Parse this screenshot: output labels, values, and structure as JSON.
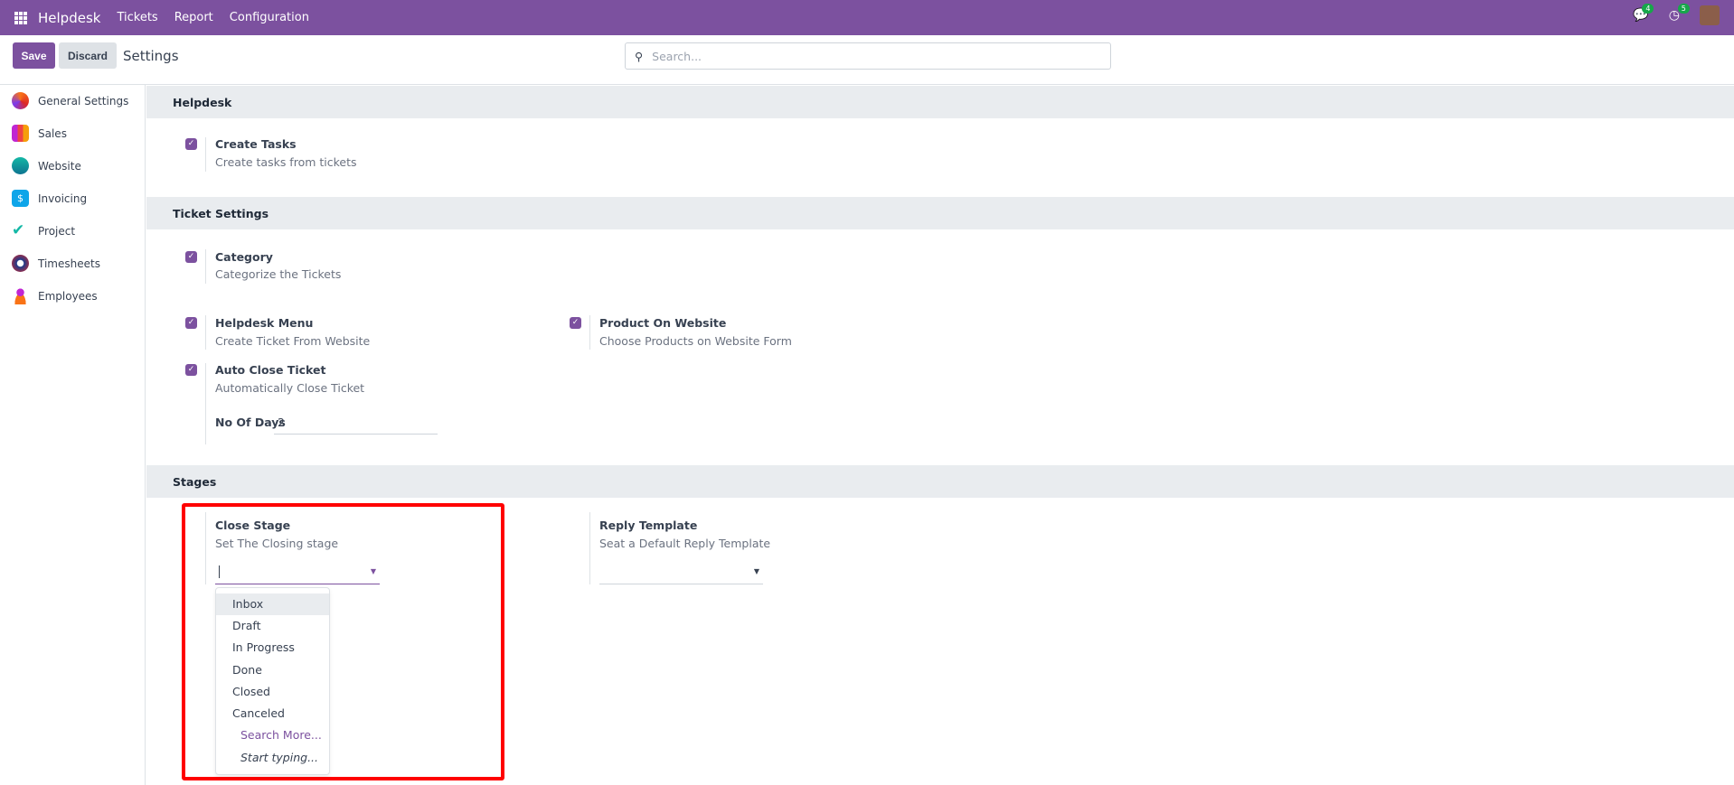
{
  "navbar": {
    "app": "Helpdesk",
    "menus": [
      "Tickets",
      "Report",
      "Configuration"
    ],
    "messages_count": "4",
    "activities_count": "5",
    "brand_color": "#7c519f"
  },
  "control": {
    "save": "Save",
    "discard": "Discard",
    "title": "Settings",
    "search_placeholder": "Search..."
  },
  "sidebar": {
    "items": [
      {
        "label": "General Settings",
        "icon": "general-settings-icon"
      },
      {
        "label": "Sales",
        "icon": "sales-icon"
      },
      {
        "label": "Website",
        "icon": "website-icon"
      },
      {
        "label": "Invoicing",
        "icon": "invoicing-icon"
      },
      {
        "label": "Project",
        "icon": "project-icon"
      },
      {
        "label": "Timesheets",
        "icon": "timesheets-icon"
      },
      {
        "label": "Employees",
        "icon": "employees-icon"
      }
    ]
  },
  "sections": {
    "helpdesk": {
      "title": "Helpdesk",
      "create_tasks": {
        "label": "Create Tasks",
        "desc": "Create tasks from tickets",
        "checked": true
      }
    },
    "ticket": {
      "title": "Ticket Settings",
      "category": {
        "label": "Category",
        "desc": "Categorize the Tickets",
        "checked": true
      },
      "helpdesk_menu": {
        "label": "Helpdesk Menu",
        "desc": "Create Ticket From Website",
        "checked": true
      },
      "product_website": {
        "label": "Product On Website",
        "desc": "Choose Products on Website Form",
        "checked": true
      },
      "auto_close": {
        "label": "Auto Close Ticket",
        "desc": "Automatically Close Ticket",
        "checked": true,
        "days_label": "No Of Days",
        "days_value": "2"
      }
    },
    "stages": {
      "title": "Stages",
      "close_stage": {
        "label": "Close Stage",
        "desc": "Set The Closing stage",
        "value": "",
        "options": [
          "Inbox",
          "Draft",
          "In Progress",
          "Done",
          "Closed",
          "Canceled"
        ],
        "search_more": "Search More...",
        "start_typing": "Start typing..."
      },
      "reply_template": {
        "label": "Reply Template",
        "desc": "Seat a Default Reply Template",
        "value": ""
      }
    }
  }
}
